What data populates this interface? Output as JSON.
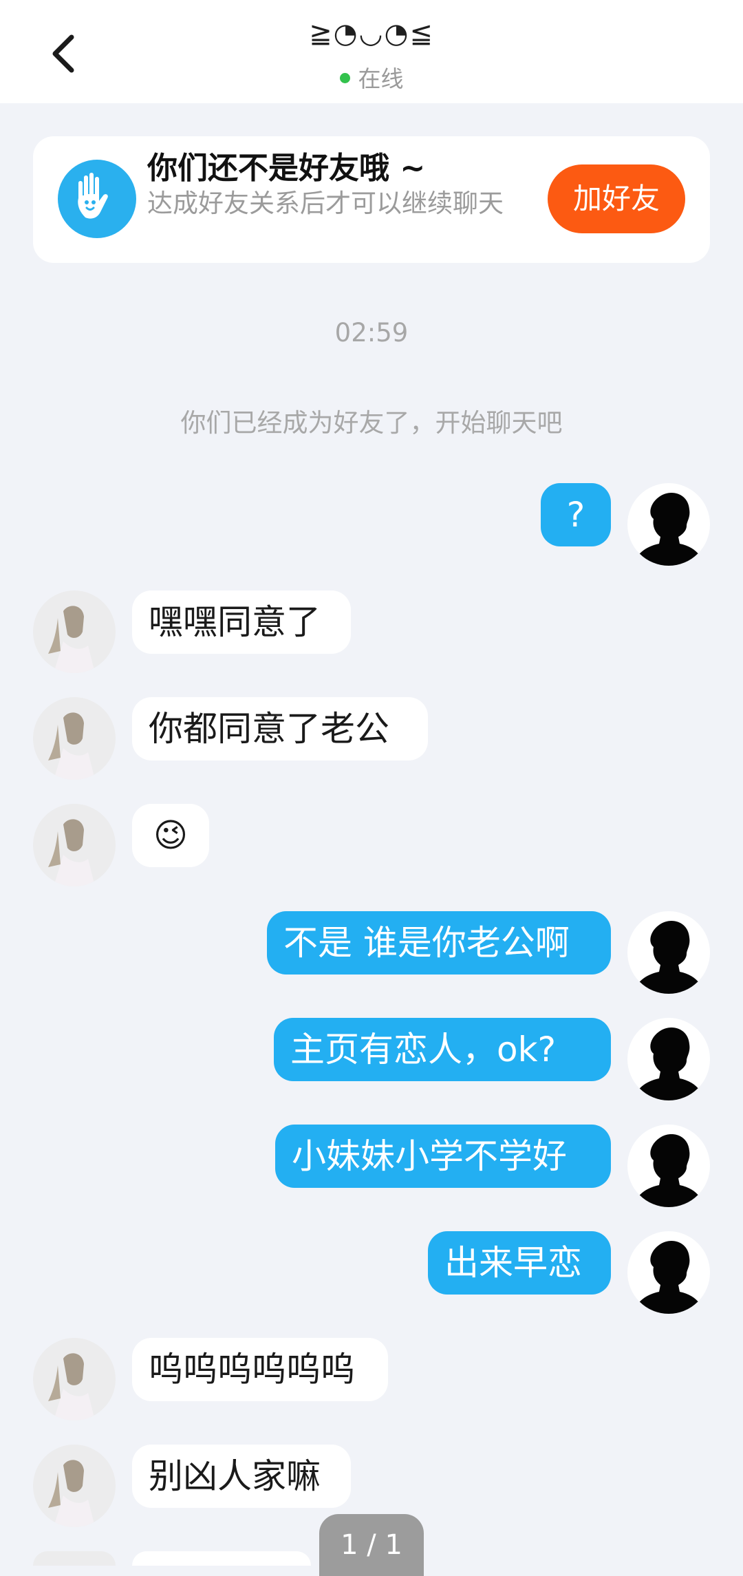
{
  "header": {
    "title": "≧◔◡◔≦",
    "status": "在线",
    "status_color": "#33c24d"
  },
  "friend_card": {
    "title": "你们还不是好友哦 ~",
    "subtitle": "达成好友关系后才可以继续聊天",
    "button": "加好友",
    "button_color": "#fc5a12"
  },
  "timestamp": "02:59",
  "system_message": "你们已经成为好友了，开始聊天吧",
  "messages": [
    {
      "from": "me",
      "text": "?"
    },
    {
      "from": "them",
      "text": "嘿嘿同意了"
    },
    {
      "from": "them",
      "text": "你都同意了老公"
    },
    {
      "from": "them",
      "text": "😉"
    },
    {
      "from": "me",
      "text": "不是 谁是你老公啊"
    },
    {
      "from": "me",
      "text": "主页有恋人，ok?"
    },
    {
      "from": "me",
      "text": "小妹妹小学不学好"
    },
    {
      "from": "me",
      "text": "出来早恋"
    },
    {
      "from": "them",
      "text": "呜呜呜呜呜呜"
    },
    {
      "from": "them",
      "text": "别凶人家嘛"
    }
  ],
  "pager": "1 / 1",
  "colors": {
    "my_bubble": "#23aff2",
    "their_bubble": "#ffffff",
    "background": "#f1f3f8"
  }
}
